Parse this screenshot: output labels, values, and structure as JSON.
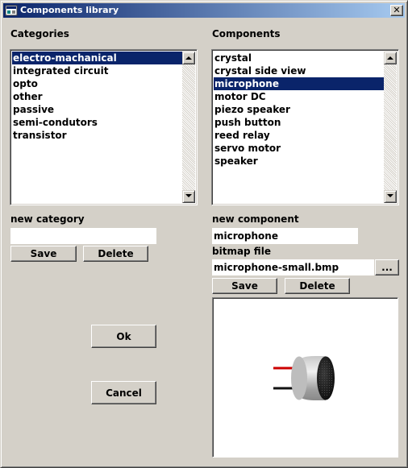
{
  "window": {
    "title": "Components library",
    "close_label": "✕"
  },
  "categories": {
    "label": "Categories",
    "items": [
      {
        "label": "electro-machanical",
        "selected": true
      },
      {
        "label": "integrated circuit",
        "selected": false
      },
      {
        "label": "opto",
        "selected": false
      },
      {
        "label": "other",
        "selected": false
      },
      {
        "label": "passive",
        "selected": false
      },
      {
        "label": "semi-condutors",
        "selected": false
      },
      {
        "label": "transistor",
        "selected": false
      }
    ],
    "new_label": "new category",
    "new_value": "",
    "save_label": "Save",
    "delete_label": "Delete"
  },
  "components": {
    "label": "Components",
    "items": [
      {
        "label": "crystal",
        "selected": false
      },
      {
        "label": "crystal side view",
        "selected": false
      },
      {
        "label": "microphone",
        "selected": true
      },
      {
        "label": "motor DC",
        "selected": false
      },
      {
        "label": "piezo speaker",
        "selected": false
      },
      {
        "label": "push button",
        "selected": false
      },
      {
        "label": "reed relay",
        "selected": false
      },
      {
        "label": "servo motor",
        "selected": false
      },
      {
        "label": "speaker",
        "selected": false
      }
    ],
    "new_label": "new component",
    "new_value": "microphone",
    "bitmap_label": "bitmap file",
    "bitmap_value": "microphone-small.bmp",
    "browse_label": "...",
    "save_label": "Save",
    "delete_label": "Delete"
  },
  "dialog": {
    "ok_label": "Ok",
    "cancel_label": "Cancel"
  },
  "preview": {
    "icon": "microphone-image"
  },
  "colors": {
    "title_start": "#0a246a",
    "title_end": "#a6caf0",
    "selection": "#0a246a",
    "face": "#d4d0c8"
  }
}
